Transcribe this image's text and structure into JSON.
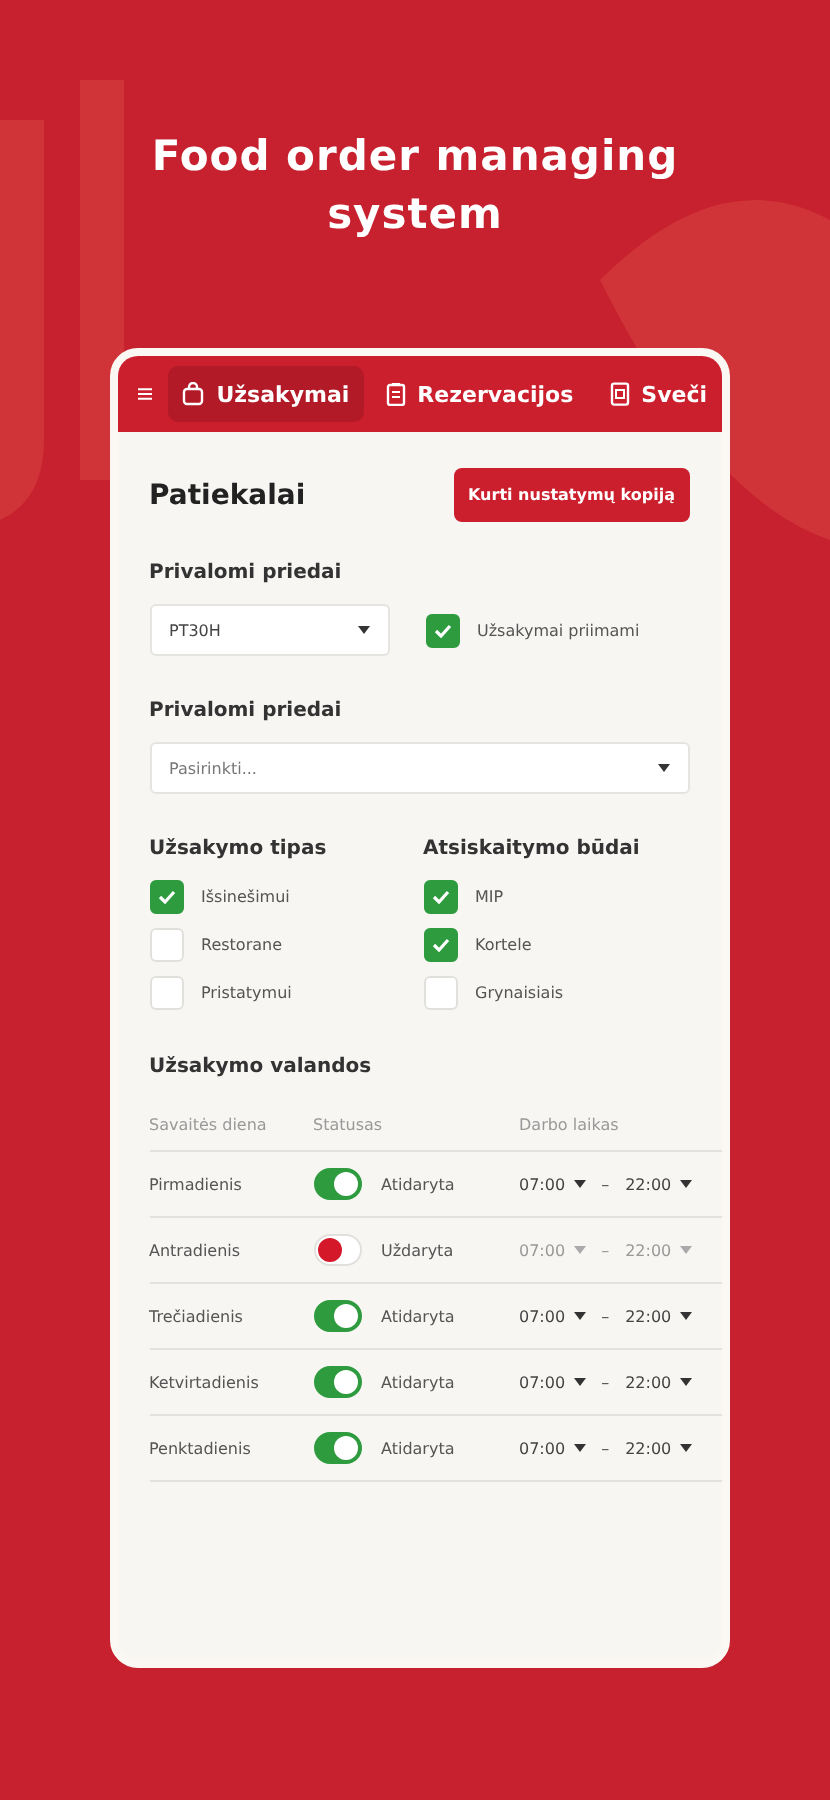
{
  "headline": "Food order managing system",
  "tabs": [
    {
      "label": "Užsakymai",
      "selected": true
    },
    {
      "label": "Rezervacijos",
      "selected": false
    },
    {
      "label": "Sveči",
      "selected": false
    }
  ],
  "title": "Patiekalai",
  "copy_button": "Kurti nustatymų kopiją",
  "required_addons": {
    "label": "Privalomi priedai",
    "select": "PT30H",
    "checkbox": {
      "label": "Užsakymai priimami",
      "checked": true
    }
  },
  "optional_addons": {
    "label": "Privalomi priedai",
    "placeholder": "Pasirinkti..."
  },
  "order_types": {
    "label": "Užsakymo tipas",
    "options": [
      {
        "label": "Išsinešimui",
        "checked": true
      },
      {
        "label": "Restorane",
        "checked": false
      },
      {
        "label": "Pristatymui",
        "checked": false
      }
    ]
  },
  "payment_methods": {
    "label": "Atsiskaitymo būdai",
    "options": [
      {
        "label": "MIP",
        "checked": true
      },
      {
        "label": "Kortele",
        "checked": true
      },
      {
        "label": "Grynaisiais",
        "checked": false
      }
    ]
  },
  "hours": {
    "label": "Užsakymo valandos",
    "columns": [
      "Savaitės diena",
      "Statusas",
      "Darbo laikas"
    ],
    "rows": [
      {
        "day": "Pirmadienis",
        "on": true,
        "status": "Atidaryta",
        "from": "07:00",
        "separator": "–",
        "to": "22:00"
      },
      {
        "day": "Antradienis",
        "on": false,
        "status": "Uždaryta",
        "from": "07:00",
        "separator": "–",
        "to": "22:00"
      },
      {
        "day": "Trečiadienis",
        "on": true,
        "status": "Atidaryta",
        "from": "07:00",
        "separator": "–",
        "to": "22:00"
      },
      {
        "day": "Ketvirtadienis",
        "on": true,
        "status": "Atidaryta",
        "from": "07:00",
        "separator": "–",
        "to": "22:00"
      },
      {
        "day": "Penktadienis",
        "on": true,
        "status": "Atidaryta",
        "from": "07:00",
        "separator": "–",
        "to": "22:00"
      }
    ]
  }
}
